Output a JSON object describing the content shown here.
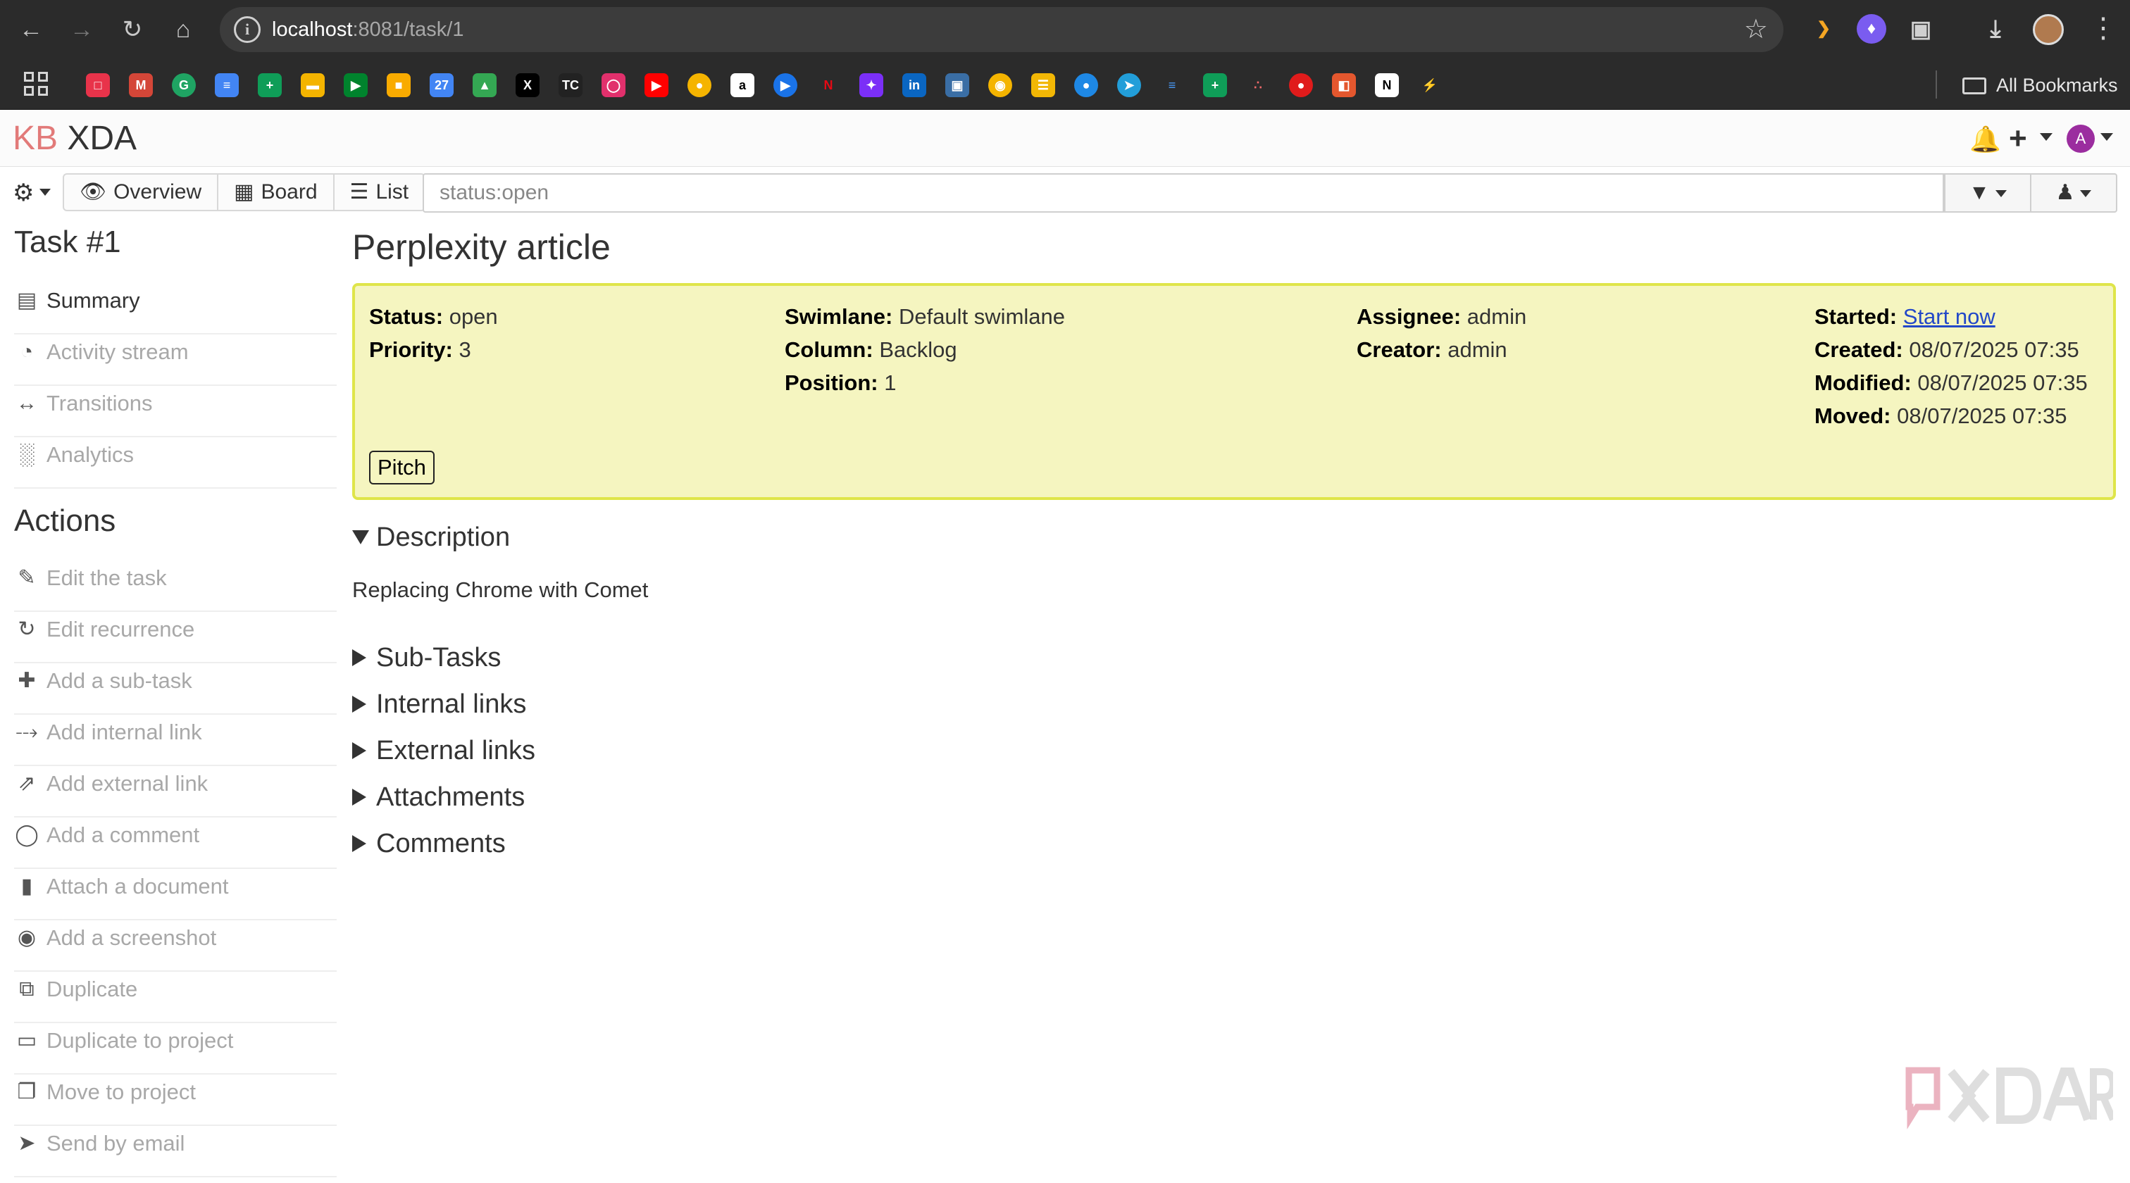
{
  "browser": {
    "url_host": "localhost",
    "url_path": ":8081/task/1",
    "all_bookmarks_label": "All Bookmarks"
  },
  "app": {
    "logo_prefix": "KB",
    "project_name": "XDA",
    "user_initial": "A"
  },
  "toolbar": {
    "overview_label": "Overview",
    "board_label": "Board",
    "list_label": "List",
    "filter_value": "status:open"
  },
  "sidebar": {
    "task_heading": "Task #1",
    "nav": [
      {
        "label": "Summary",
        "icon": "newspaper-icon"
      },
      {
        "label": "Activity stream",
        "icon": "dashboard-icon"
      },
      {
        "label": "Transitions",
        "icon": "arrows-h-icon"
      },
      {
        "label": "Analytics",
        "icon": "bar-chart-icon"
      }
    ],
    "actions_heading": "Actions",
    "actions": [
      {
        "label": "Edit the task",
        "icon": "edit-icon"
      },
      {
        "label": "Edit recurrence",
        "icon": "refresh-icon"
      },
      {
        "label": "Add a sub-task",
        "icon": "plus-icon"
      },
      {
        "label": "Add internal link",
        "icon": "code-fork-icon"
      },
      {
        "label": "Add external link",
        "icon": "external-link-icon"
      },
      {
        "label": "Add a comment",
        "icon": "comment-icon"
      },
      {
        "label": "Attach a document",
        "icon": "file-icon"
      },
      {
        "label": "Add a screenshot",
        "icon": "camera-icon"
      },
      {
        "label": "Duplicate",
        "icon": "clone-icon"
      },
      {
        "label": "Duplicate to project",
        "icon": "files-icon"
      },
      {
        "label": "Move to project",
        "icon": "clone-outline-icon"
      },
      {
        "label": "Send by email",
        "icon": "paper-plane-icon"
      }
    ]
  },
  "task": {
    "title": "Perplexity article",
    "status_label": "Status:",
    "status_value": "open",
    "priority_label": "Priority:",
    "priority_value": "3",
    "swimlane_label": "Swimlane:",
    "swimlane_value": "Default swimlane",
    "column_label": "Column:",
    "column_value": "Backlog",
    "position_label": "Position:",
    "position_value": "1",
    "assignee_label": "Assignee:",
    "assignee_value": "admin",
    "creator_label": "Creator:",
    "creator_value": "admin",
    "started_label": "Started:",
    "started_value": "Start now",
    "created_label": "Created:",
    "created_value": "08/07/2025 07:35",
    "modified_label": "Modified:",
    "modified_value": "08/07/2025 07:35",
    "moved_label": "Moved:",
    "moved_value": "08/07/2025 07:35",
    "tag": "Pitch",
    "box_color": "#f5f5c0",
    "box_border_color": "#dfe54a"
  },
  "sections": {
    "description_heading": "Description",
    "description_text": "Replacing Chrome with Comet",
    "collapsed": [
      "Sub-Tasks",
      "Internal links",
      "External links",
      "Attachments",
      "Comments"
    ]
  }
}
